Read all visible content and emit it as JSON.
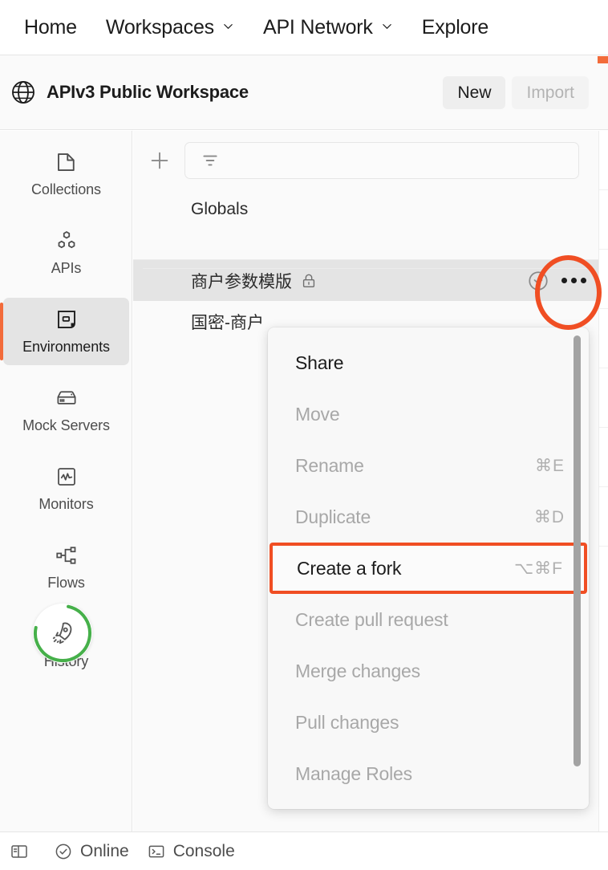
{
  "topnav": {
    "items": [
      {
        "label": "Home",
        "has_caret": false
      },
      {
        "label": "Workspaces",
        "has_caret": true
      },
      {
        "label": "API Network",
        "has_caret": true
      },
      {
        "label": "Explore",
        "has_caret": false
      }
    ]
  },
  "workspace_header": {
    "icon": "globe-icon",
    "title": "APIv3 Public Workspace",
    "new_label": "New",
    "import_label": "Import"
  },
  "sidebar": {
    "items": [
      {
        "label": "Collections",
        "icon": "collections-icon",
        "active": false
      },
      {
        "label": "APIs",
        "icon": "apis-icon",
        "active": false
      },
      {
        "label": "Environments",
        "icon": "environments-icon",
        "active": true
      },
      {
        "label": "Mock Servers",
        "icon": "mock-servers-icon",
        "active": false
      },
      {
        "label": "Monitors",
        "icon": "monitors-icon",
        "active": false
      },
      {
        "label": "Flows",
        "icon": "flows-icon",
        "active": false
      },
      {
        "label": "History",
        "icon": "history-icon",
        "active": false
      }
    ],
    "rocket_badge": {
      "icon": "rocket-icon",
      "progress_percent": 75,
      "ring_color": "#46b04a"
    }
  },
  "panel": {
    "toolbar": {
      "add_icon": "plus-icon",
      "filter_icon": "filter-sort-icon",
      "filter_placeholder": ""
    },
    "rows": [
      {
        "name": "Globals",
        "locked": false,
        "selected": false,
        "has_actions": false
      },
      {
        "name": "商户参数模版",
        "locked": true,
        "selected": true,
        "has_actions": true
      },
      {
        "name": "国密-商户",
        "locked": false,
        "selected": false,
        "has_actions": false
      }
    ]
  },
  "context_menu": {
    "items": [
      {
        "label": "Share",
        "shortcut": "",
        "state": "enabled",
        "highlighted": false
      },
      {
        "label": "Move",
        "shortcut": "",
        "state": "disabled",
        "highlighted": false
      },
      {
        "label": "Rename",
        "shortcut": "⌘E",
        "state": "disabled",
        "highlighted": false
      },
      {
        "label": "Duplicate",
        "shortcut": "⌘D",
        "state": "disabled",
        "highlighted": false
      },
      {
        "label": "Create a fork",
        "shortcut": "⌥⌘F",
        "state": "enabled",
        "highlighted": true
      },
      {
        "label": "Create pull request",
        "shortcut": "",
        "state": "disabled",
        "highlighted": false
      },
      {
        "label": "Merge changes",
        "shortcut": "",
        "state": "disabled",
        "highlighted": false
      },
      {
        "label": "Pull changes",
        "shortcut": "",
        "state": "disabled",
        "highlighted": false
      },
      {
        "label": "Manage Roles",
        "shortcut": "",
        "state": "disabled",
        "highlighted": false
      }
    ]
  },
  "statusbar": {
    "items": [
      {
        "label": "",
        "icon": "sidebar-toggle-icon"
      },
      {
        "label": "Online",
        "icon": "status-online-icon"
      },
      {
        "label": "Console",
        "icon": "console-icon"
      }
    ]
  },
  "colors": {
    "accent_orange": "#f26b3a",
    "annotation_orange": "#f04e23",
    "online_green": "#46b04a",
    "selected_row_bg": "#e4e4e4"
  }
}
